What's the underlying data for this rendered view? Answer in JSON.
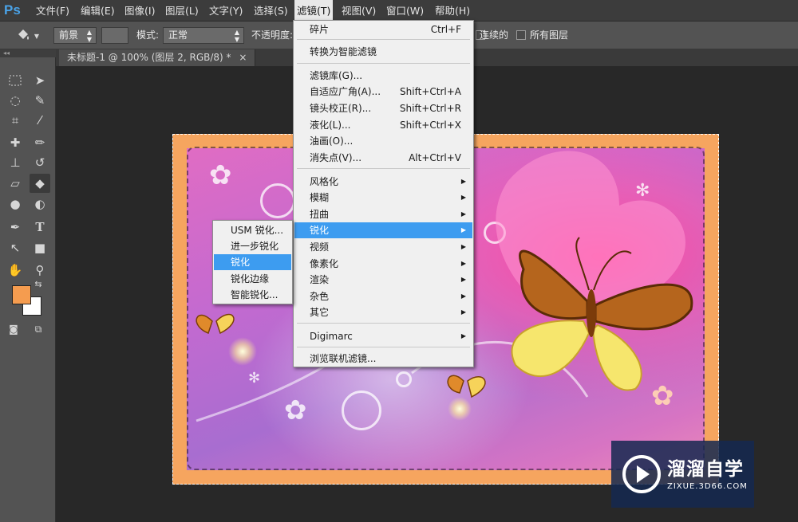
{
  "app": {
    "logo": "Ps"
  },
  "menubar": {
    "items": [
      "文件(F)",
      "编辑(E)",
      "图像(I)",
      "图层(L)",
      "文字(Y)",
      "选择(S)",
      "滤镜(T)",
      "视图(V)",
      "窗口(W)",
      "帮助(H)"
    ],
    "active": "滤镜(T)"
  },
  "options": {
    "fill_source": "前景",
    "mode_label": "模式:",
    "mode_value": "正常",
    "opacity_label": "不透明度:",
    "contiguous_label": "连续的",
    "all_layers_label": "所有图层"
  },
  "document": {
    "tab_title": "未标题-1 @ 100% (图层 2, RGB/8) *",
    "close": "×"
  },
  "filter_menu": {
    "last_filter": {
      "label": "碎片",
      "shortcut": "Ctrl+F"
    },
    "smart_filter": "转换为智能滤镜",
    "group1": [
      {
        "label": "滤镜库(G)...",
        "shortcut": ""
      },
      {
        "label": "自适应广角(A)...",
        "shortcut": "Shift+Ctrl+A"
      },
      {
        "label": "镜头校正(R)...",
        "shortcut": "Shift+Ctrl+R"
      },
      {
        "label": "液化(L)...",
        "shortcut": "Shift+Ctrl+X"
      },
      {
        "label": "油画(O)...",
        "shortcut": ""
      },
      {
        "label": "消失点(V)...",
        "shortcut": "Alt+Ctrl+V"
      }
    ],
    "group2": [
      "风格化",
      "模糊",
      "扭曲",
      "锐化",
      "视频",
      "像素化",
      "渲染",
      "杂色",
      "其它"
    ],
    "highlighted": "锐化",
    "digimarc": "Digimarc",
    "browse_online": "浏览联机滤镜..."
  },
  "sharpen_submenu": {
    "items": [
      "USM 锐化...",
      "进一步锐化",
      "锐化",
      "锐化边缘",
      "智能锐化..."
    ],
    "highlighted": "锐化"
  },
  "colors": {
    "foreground": "#f59c4f",
    "background": "#ffffff",
    "highlight": "#3d9cf0"
  },
  "watermark": {
    "title": "溜溜自学",
    "url": "ZIXUE.3D66.COM"
  }
}
